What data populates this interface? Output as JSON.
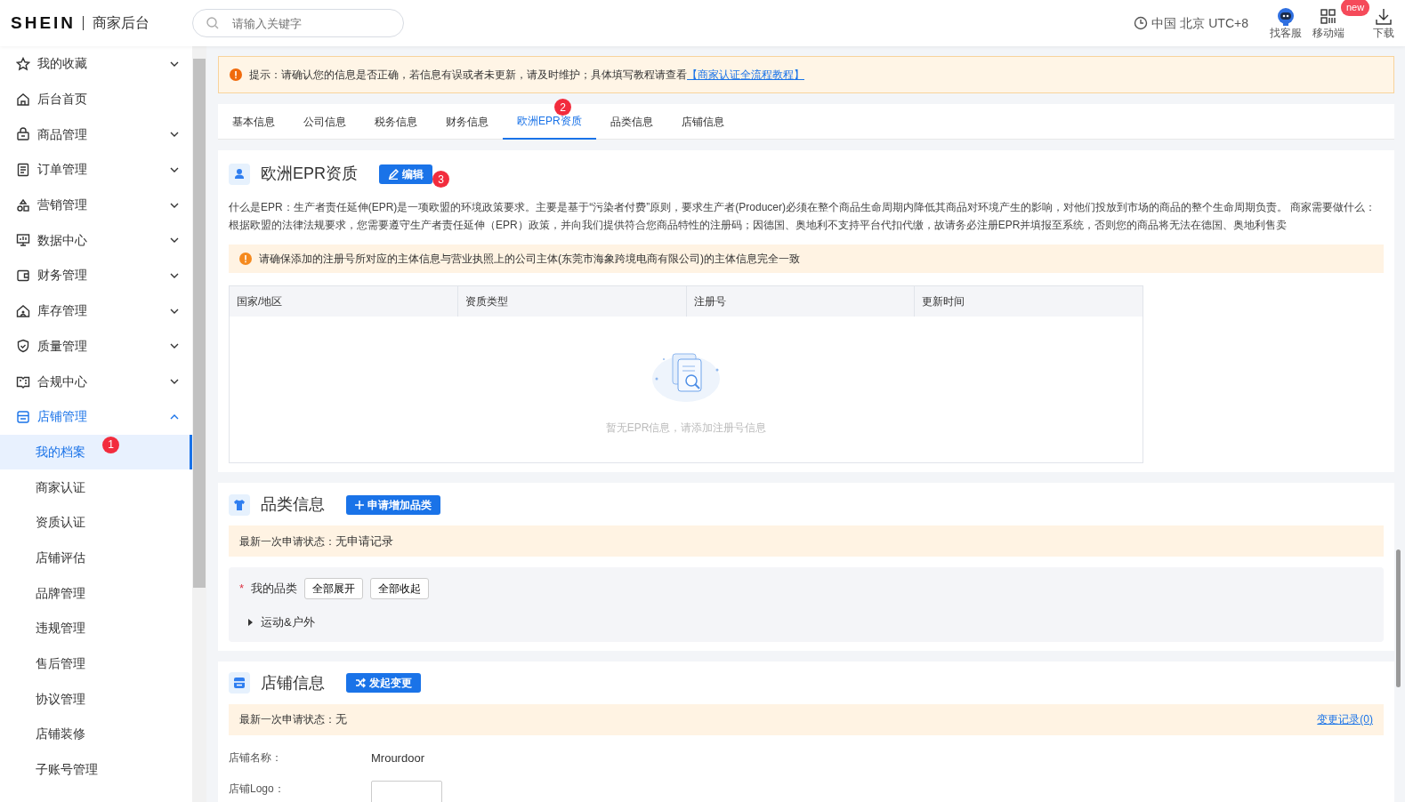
{
  "header": {
    "logo": "SHEIN",
    "subtitle": "商家后台",
    "search": {
      "placeholder": "请输入关键字"
    },
    "timezone": "中国 北京 UTC+8",
    "tools": [
      {
        "label": "找客服"
      },
      {
        "label": "移动端",
        "badge": "new"
      },
      {
        "label": "下载"
      }
    ]
  },
  "sidebar": {
    "items": [
      {
        "label": "我的收藏",
        "expanded": false,
        "selected": false
      },
      {
        "label": "后台首页",
        "selected": false
      },
      {
        "label": "商品管理",
        "expanded": false,
        "selected": false
      },
      {
        "label": "订单管理",
        "expanded": false,
        "selected": false
      },
      {
        "label": "营销管理",
        "expanded": false,
        "selected": false
      },
      {
        "label": "数据中心",
        "expanded": false,
        "selected": false
      },
      {
        "label": "财务管理",
        "expanded": false,
        "selected": false
      },
      {
        "label": "库存管理",
        "expanded": false,
        "selected": false
      },
      {
        "label": "质量管理",
        "expanded": false,
        "selected": false
      },
      {
        "label": "合规中心",
        "expanded": false,
        "selected": false
      },
      {
        "label": "店铺管理",
        "expanded": true,
        "selected": true,
        "children": [
          {
            "label": "我的档案",
            "selected": true,
            "marker": "1"
          },
          {
            "label": "商家认证",
            "selected": false
          },
          {
            "label": "资质认证",
            "selected": false
          },
          {
            "label": "店铺评估",
            "selected": false
          },
          {
            "label": "品牌管理",
            "selected": false
          },
          {
            "label": "违规管理",
            "selected": false
          },
          {
            "label": "售后管理",
            "selected": false
          },
          {
            "label": "协议管理",
            "selected": false
          },
          {
            "label": "店铺装修",
            "selected": false
          },
          {
            "label": "子账号管理",
            "selected": false
          }
        ]
      }
    ]
  },
  "notice": {
    "text": "提示：请确认您的信息是否正确，若信息有误或者未更新，请及时维护；具体填写教程请查看",
    "link": "【商家认证全流程教程】"
  },
  "tabs": [
    {
      "label": "基本信息",
      "selected": false
    },
    {
      "label": "公司信息",
      "selected": false
    },
    {
      "label": "税务信息",
      "selected": false
    },
    {
      "label": "财务信息",
      "selected": false
    },
    {
      "label": "欧洲EPR资质",
      "selected": true,
      "marker": "2"
    },
    {
      "label": "品类信息",
      "selected": false
    },
    {
      "label": "店铺信息",
      "selected": false
    }
  ],
  "epr": {
    "title": "欧洲EPR资质",
    "button": {
      "label": "编辑",
      "marker": "3"
    },
    "description": "什么是EPR：生产者责任延伸(EPR)是一项欧盟的环境政策要求。主要是基于“污染者付费”原则，要求生产者(Producer)必须在整个商品生命周期内降低其商品对环境产生的影响，对他们投放到市场的商品的整个生命周期负责。 商家需要做什么：根据欧盟的法律法规要求，您需要遵守生产者责任延伸（EPR）政策，并向我们提供符合您商品特性的注册码；因德国、奥地利不支持平台代扣代缴，故请务必注册EPR并填报至系统，否则您的商品将无法在德国、奥地利售卖",
    "warning": "请确保添加的注册号所对应的主体信息与营业执照上的公司主体(东莞市海象跨境电商有限公司)的主体信息完全一致",
    "table": {
      "columns": [
        "国家/地区",
        "资质类型",
        "注册号",
        "更新时间"
      ],
      "empty_text": "暂无EPR信息，请添加注册号信息"
    }
  },
  "category": {
    "title": "品类信息",
    "button": "申请增加品类",
    "status_label": "最新一次申请状态：",
    "status": "无申请记录",
    "field_label": "我的品类",
    "required_mark": "*",
    "actions": [
      "全部展开",
      "全部收起"
    ],
    "tree": [
      {
        "label": "运动&户外",
        "expanded": false
      }
    ]
  },
  "store": {
    "title": "店铺信息",
    "button": "发起变更",
    "status_label": "最新一次申请状态：",
    "status": "无",
    "history_link": "变更记录(0)",
    "fields": [
      {
        "label": "店铺名称：",
        "value": "Mrourdoor",
        "kind": "text"
      },
      {
        "label": "店铺Logo：",
        "kind": "image"
      }
    ]
  }
}
